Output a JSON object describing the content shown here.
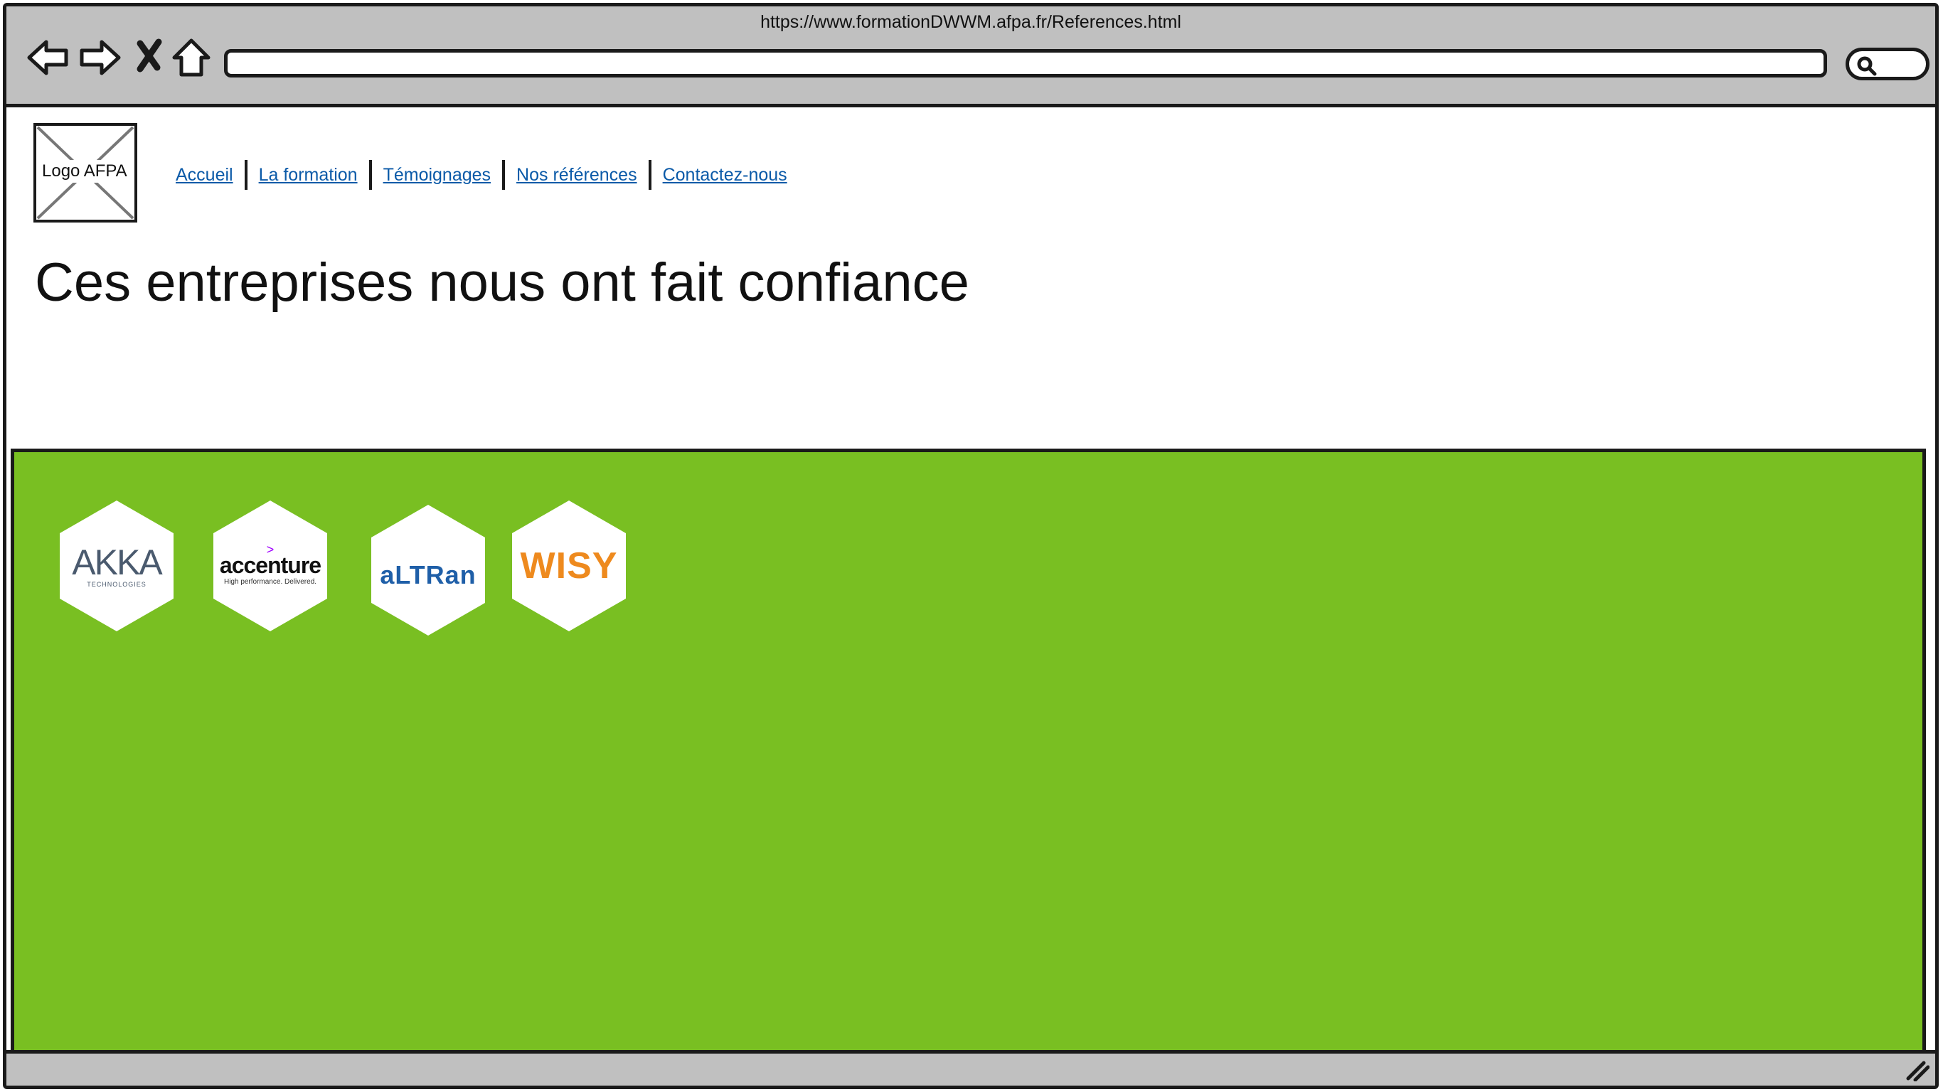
{
  "browser": {
    "url": "https://www.formationDWWM.afpa.fr/References.html"
  },
  "header": {
    "logo_label": "Logo AFPA",
    "menu": [
      {
        "label": "Accueil"
      },
      {
        "label": "La formation"
      },
      {
        "label": "Témoignages"
      },
      {
        "label": "Nos références"
      },
      {
        "label": "Contactez-nous"
      }
    ]
  },
  "main": {
    "title": "Ces entreprises nous ont fait confiance",
    "panel_color": "#79bf22",
    "references": [
      {
        "name": "AKKA",
        "tagline": "TECHNOLOGIES",
        "color": "#4a5a6e"
      },
      {
        "name": "accenture",
        "tagline": "High performance. Delivered.",
        "color": "#111111"
      },
      {
        "name": "aLTRan",
        "color": "#1f5fa8"
      },
      {
        "name": "WISY",
        "color": "#ee8a1e"
      }
    ]
  }
}
